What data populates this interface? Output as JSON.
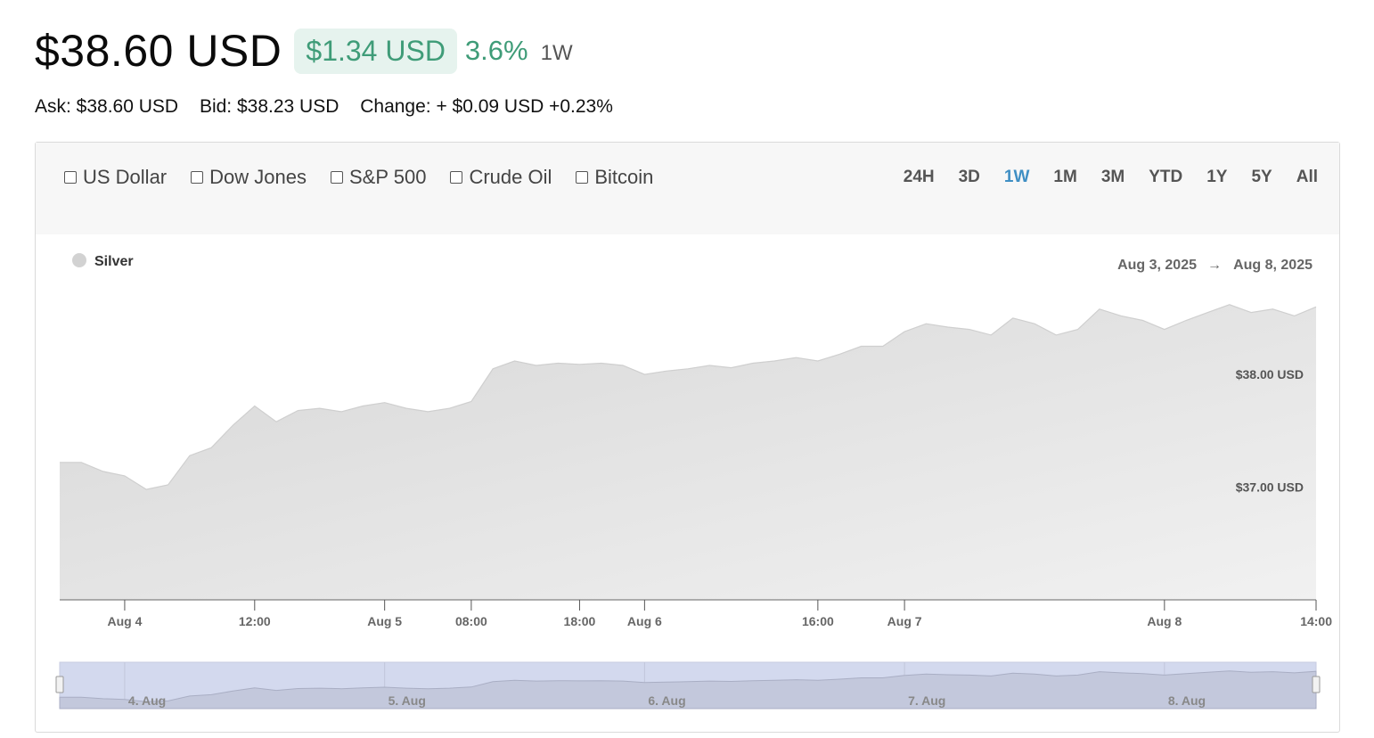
{
  "header": {
    "price": "$38.60 USD",
    "change_amount": "$1.34 USD",
    "change_percent": "3.6%",
    "period": "1W"
  },
  "quote": {
    "ask": "Ask: $38.60 USD",
    "bid": "Bid: $38.23 USD",
    "change": "Change: + $0.09 USD +0.23%"
  },
  "compare_options": [
    "US Dollar",
    "Dow Jones",
    "S&P 500",
    "Crude Oil",
    "Bitcoin"
  ],
  "ranges": [
    "24H",
    "3D",
    "1W",
    "1M",
    "3M",
    "YTD",
    "1Y",
    "5Y",
    "All"
  ],
  "active_range": "1W",
  "colors": {
    "accent": "#3f8fc4",
    "gain": "#3f9c78",
    "navigator": "#d3d9ee"
  },
  "chart_data": {
    "type": "area",
    "series": [
      {
        "name": "Silver",
        "points": [
          [
            "2025-08-03 18:00",
            37.22
          ],
          [
            "2025-08-03 20:00",
            37.22
          ],
          [
            "2025-08-03 22:00",
            37.14
          ],
          [
            "2025-08-04 00:00",
            37.1
          ],
          [
            "2025-08-04 02:00",
            36.98
          ],
          [
            "2025-08-04 04:00",
            37.02
          ],
          [
            "2025-08-04 06:00",
            37.28
          ],
          [
            "2025-08-04 08:00",
            37.35
          ],
          [
            "2025-08-04 10:00",
            37.55
          ],
          [
            "2025-08-04 12:00",
            37.72
          ],
          [
            "2025-08-04 14:00",
            37.58
          ],
          [
            "2025-08-04 16:00",
            37.68
          ],
          [
            "2025-08-04 18:00",
            37.7
          ],
          [
            "2025-08-04 20:00",
            37.67
          ],
          [
            "2025-08-04 22:00",
            37.72
          ],
          [
            "2025-08-05 00:00",
            37.75
          ],
          [
            "2025-08-05 02:00",
            37.7
          ],
          [
            "2025-08-05 04:00",
            37.67
          ],
          [
            "2025-08-05 06:00",
            37.7
          ],
          [
            "2025-08-05 08:00",
            37.76
          ],
          [
            "2025-08-05 10:00",
            38.05
          ],
          [
            "2025-08-05 12:00",
            38.12
          ],
          [
            "2025-08-05 14:00",
            38.08
          ],
          [
            "2025-08-05 16:00",
            38.1
          ],
          [
            "2025-08-05 18:00",
            38.09
          ],
          [
            "2025-08-05 20:00",
            38.1
          ],
          [
            "2025-08-05 22:00",
            38.08
          ],
          [
            "2025-08-06 00:00",
            38.0
          ],
          [
            "2025-08-06 02:00",
            38.03
          ],
          [
            "2025-08-06 04:00",
            38.05
          ],
          [
            "2025-08-06 06:00",
            38.08
          ],
          [
            "2025-08-06 08:00",
            38.06
          ],
          [
            "2025-08-06 10:00",
            38.1
          ],
          [
            "2025-08-06 12:00",
            38.12
          ],
          [
            "2025-08-06 14:00",
            38.15
          ],
          [
            "2025-08-06 16:00",
            38.12
          ],
          [
            "2025-08-06 18:00",
            38.18
          ],
          [
            "2025-08-06 20:00",
            38.25
          ],
          [
            "2025-08-06 22:00",
            38.25
          ],
          [
            "2025-08-07 00:00",
            38.38
          ],
          [
            "2025-08-07 02:00",
            38.45
          ],
          [
            "2025-08-07 04:00",
            38.42
          ],
          [
            "2025-08-07 06:00",
            38.4
          ],
          [
            "2025-08-07 08:00",
            38.35
          ],
          [
            "2025-08-07 10:00",
            38.5
          ],
          [
            "2025-08-07 12:00",
            38.45
          ],
          [
            "2025-08-07 14:00",
            38.35
          ],
          [
            "2025-08-07 16:00",
            38.4
          ],
          [
            "2025-08-07 18:00",
            38.58
          ],
          [
            "2025-08-07 20:00",
            38.52
          ],
          [
            "2025-08-07 22:00",
            38.48
          ],
          [
            "2025-08-08 00:00",
            38.4
          ],
          [
            "2025-08-08 02:00",
            38.48
          ],
          [
            "2025-08-08 04:00",
            38.55
          ],
          [
            "2025-08-08 06:00",
            38.62
          ],
          [
            "2025-08-08 08:00",
            38.55
          ],
          [
            "2025-08-08 10:00",
            38.58
          ],
          [
            "2025-08-08 12:00",
            38.52
          ],
          [
            "2025-08-08 14:00",
            38.6
          ]
        ]
      }
    ],
    "date_range": {
      "from": "Aug 3, 2025",
      "arrow": "→",
      "to": "Aug 8, 2025"
    },
    "y_ticks": [
      {
        "value": 38.0,
        "label": "$38.00 USD"
      },
      {
        "value": 37.0,
        "label": "$37.00 USD"
      }
    ],
    "x_ticks": [
      {
        "time": "2025-08-04 00:00",
        "label": "Aug 4"
      },
      {
        "time": "2025-08-04 12:00",
        "label": "12:00"
      },
      {
        "time": "2025-08-05 00:00",
        "label": "Aug 5"
      },
      {
        "time": "2025-08-05 08:00",
        "label": "08:00"
      },
      {
        "time": "2025-08-05 18:00",
        "label": "18:00"
      },
      {
        "time": "2025-08-06 00:00",
        "label": "Aug 6"
      },
      {
        "time": "2025-08-06 16:00",
        "label": "16:00"
      },
      {
        "time": "2025-08-07 00:00",
        "label": "Aug 7"
      },
      {
        "time": "2025-08-08 00:00",
        "label": "Aug 8"
      },
      {
        "time": "2025-08-08 14:00",
        "label": "14:00"
      }
    ],
    "navigator_ticks": [
      {
        "time": "2025-08-04 00:00",
        "label": "4. Aug"
      },
      {
        "time": "2025-08-05 00:00",
        "label": "5. Aug"
      },
      {
        "time": "2025-08-06 00:00",
        "label": "6. Aug"
      },
      {
        "time": "2025-08-07 00:00",
        "label": "7. Aug"
      },
      {
        "time": "2025-08-08 00:00",
        "label": "8. Aug"
      }
    ],
    "x_range": [
      "2025-08-03 18:00",
      "2025-08-08 14:00"
    ],
    "y_range": [
      36.0,
      38.8
    ],
    "legend": "top-left",
    "grid": false
  }
}
